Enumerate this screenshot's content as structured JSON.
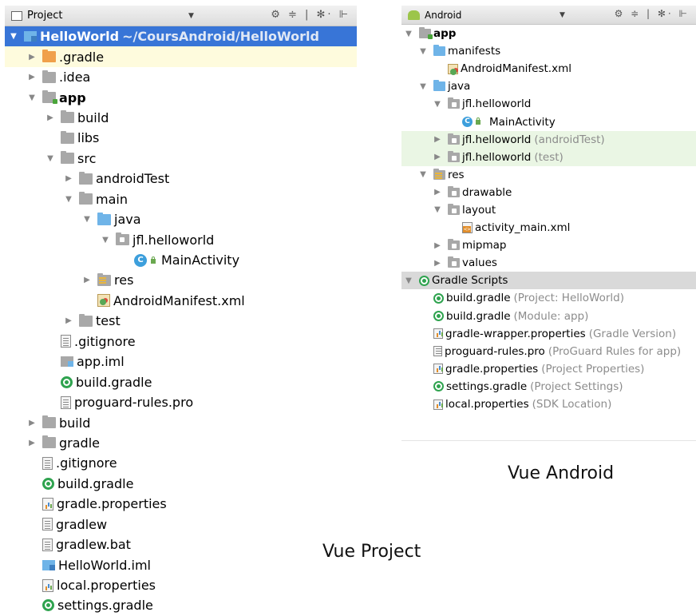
{
  "project_view": {
    "toolbar": {
      "title": "Project",
      "tools": "⚙ ≑ | ✻· ⊩"
    },
    "rows": [
      {
        "label": "HelloWorld",
        "sub": "~/CoursAndroid/HelloWorld",
        "arrow": "▼",
        "icon": "iml-blue",
        "depth": 0,
        "state": "sel",
        "bold": true
      },
      {
        "label": ".gradle",
        "arrow": "▶",
        "icon": "folder-orange",
        "depth": 1,
        "state": "yellow"
      },
      {
        "label": ".idea",
        "arrow": "▶",
        "icon": "folder",
        "depth": 1
      },
      {
        "label": "app",
        "arrow": "▼",
        "icon": "folder-mod",
        "depth": 1,
        "bold": true
      },
      {
        "label": "build",
        "arrow": "▶",
        "icon": "folder",
        "depth": 2
      },
      {
        "label": "libs",
        "arrow": "",
        "icon": "folder",
        "depth": 2
      },
      {
        "label": "src",
        "arrow": "▼",
        "icon": "folder",
        "depth": 2
      },
      {
        "label": "androidTest",
        "arrow": "▶",
        "icon": "folder",
        "depth": 3
      },
      {
        "label": "main",
        "arrow": "▼",
        "icon": "folder",
        "depth": 3
      },
      {
        "label": "java",
        "arrow": "▼",
        "icon": "folder-blue",
        "depth": 4
      },
      {
        "label": "jfl.helloworld",
        "arrow": "▼",
        "icon": "folder-pkg",
        "depth": 5
      },
      {
        "label": "MainActivity",
        "arrow": "",
        "icon": "class",
        "depth": 6
      },
      {
        "label": "res",
        "arrow": "▶",
        "icon": "folder-res",
        "depth": 4
      },
      {
        "label": "AndroidManifest.xml",
        "arrow": "",
        "icon": "manifest",
        "depth": 4
      },
      {
        "label": "test",
        "arrow": "▶",
        "icon": "folder",
        "depth": 3
      },
      {
        "label": ".gitignore",
        "arrow": "",
        "icon": "file",
        "depth": 2
      },
      {
        "label": "app.iml",
        "arrow": "",
        "icon": "iml",
        "depth": 2
      },
      {
        "label": "build.gradle",
        "arrow": "",
        "icon": "gradle",
        "depth": 2
      },
      {
        "label": "proguard-rules.pro",
        "arrow": "",
        "icon": "file",
        "depth": 2
      },
      {
        "label": "build",
        "arrow": "▶",
        "icon": "folder",
        "depth": 1
      },
      {
        "label": "gradle",
        "arrow": "▶",
        "icon": "folder",
        "depth": 1
      },
      {
        "label": ".gitignore",
        "arrow": "",
        "icon": "file",
        "depth": 1
      },
      {
        "label": "build.gradle",
        "arrow": "",
        "icon": "gradle",
        "depth": 1
      },
      {
        "label": "gradle.properties",
        "arrow": "",
        "icon": "props",
        "depth": 1
      },
      {
        "label": "gradlew",
        "arrow": "",
        "icon": "file",
        "depth": 1
      },
      {
        "label": "gradlew.bat",
        "arrow": "",
        "icon": "file",
        "depth": 1
      },
      {
        "label": "HelloWorld.iml",
        "arrow": "",
        "icon": "iml-blue",
        "depth": 1
      },
      {
        "label": "local.properties",
        "arrow": "",
        "icon": "props",
        "depth": 1
      },
      {
        "label": "settings.gradle",
        "arrow": "",
        "icon": "gradle",
        "depth": 1
      }
    ]
  },
  "android_view": {
    "toolbar": {
      "title": "Android",
      "tools": "⚙ ≑ | ✻· ⊩"
    },
    "rows": [
      {
        "label": "app",
        "arrow": "▼",
        "icon": "folder-mod",
        "depth": 0,
        "bold": true
      },
      {
        "label": "manifests",
        "arrow": "▼",
        "icon": "folder-blue",
        "depth": 1
      },
      {
        "label": "AndroidManifest.xml",
        "arrow": "",
        "icon": "manifest",
        "depth": 2
      },
      {
        "label": "java",
        "arrow": "▼",
        "icon": "folder-blue",
        "depth": 1
      },
      {
        "label": "jfl.helloworld",
        "arrow": "▼",
        "icon": "folder-pkg",
        "depth": 2
      },
      {
        "label": "MainActivity",
        "arrow": "",
        "icon": "class",
        "depth": 3
      },
      {
        "label": "jfl.helloworld",
        "sub": "(androidTest)",
        "arrow": "▶",
        "icon": "folder-pkg",
        "depth": 2,
        "state": "green"
      },
      {
        "label": "jfl.helloworld",
        "sub": "(test)",
        "arrow": "▶",
        "icon": "folder-pkg",
        "depth": 2,
        "state": "green"
      },
      {
        "label": "res",
        "arrow": "▼",
        "icon": "folder-res",
        "depth": 1
      },
      {
        "label": "drawable",
        "arrow": "▶",
        "icon": "folder-pkg",
        "depth": 2
      },
      {
        "label": "layout",
        "arrow": "▼",
        "icon": "folder-pkg",
        "depth": 2
      },
      {
        "label": "activity_main.xml",
        "arrow": "",
        "icon": "xml",
        "depth": 3
      },
      {
        "label": "mipmap",
        "arrow": "▶",
        "icon": "folder-pkg",
        "depth": 2
      },
      {
        "label": "values",
        "arrow": "▶",
        "icon": "folder-pkg",
        "depth": 2
      },
      {
        "label": "Gradle Scripts",
        "arrow": "▼",
        "icon": "gradle",
        "depth": 0,
        "state": "grey"
      },
      {
        "label": "build.gradle",
        "sub": "(Project: HelloWorld)",
        "arrow": "",
        "icon": "gradle",
        "depth": 1
      },
      {
        "label": "build.gradle",
        "sub": "(Module: app)",
        "arrow": "",
        "icon": "gradle",
        "depth": 1
      },
      {
        "label": "gradle-wrapper.properties",
        "sub": "(Gradle Version)",
        "arrow": "",
        "icon": "props",
        "depth": 1
      },
      {
        "label": "proguard-rules.pro",
        "sub": "(ProGuard Rules for app)",
        "arrow": "",
        "icon": "file",
        "depth": 1
      },
      {
        "label": "gradle.properties",
        "sub": "(Project Properties)",
        "arrow": "",
        "icon": "props",
        "depth": 1
      },
      {
        "label": "settings.gradle",
        "sub": "(Project Settings)",
        "arrow": "",
        "icon": "gradle",
        "depth": 1
      },
      {
        "label": "local.properties",
        "sub": "(SDK Location)",
        "arrow": "",
        "icon": "props",
        "depth": 1
      }
    ]
  },
  "captions": {
    "project": "Vue Project",
    "android": "Vue Android"
  },
  "colors": {
    "selection": "#3875d7",
    "highlight_yellow": "#fefbdd",
    "highlight_green": "#eaf6e4",
    "group_grey": "#d9d9d9"
  }
}
